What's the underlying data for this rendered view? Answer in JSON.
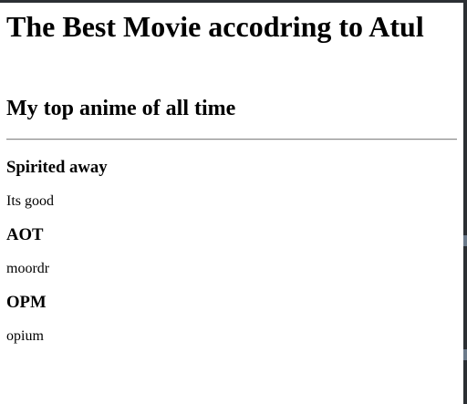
{
  "page": {
    "title": "The Best Movie accodring to Atul",
    "subtitle": "My top anime of all time",
    "items": [
      {
        "name": "Spirited away",
        "description": "Its good"
      },
      {
        "name": "AOT",
        "description": "moordr"
      },
      {
        "name": "OPM",
        "description": "opium"
      }
    ]
  }
}
